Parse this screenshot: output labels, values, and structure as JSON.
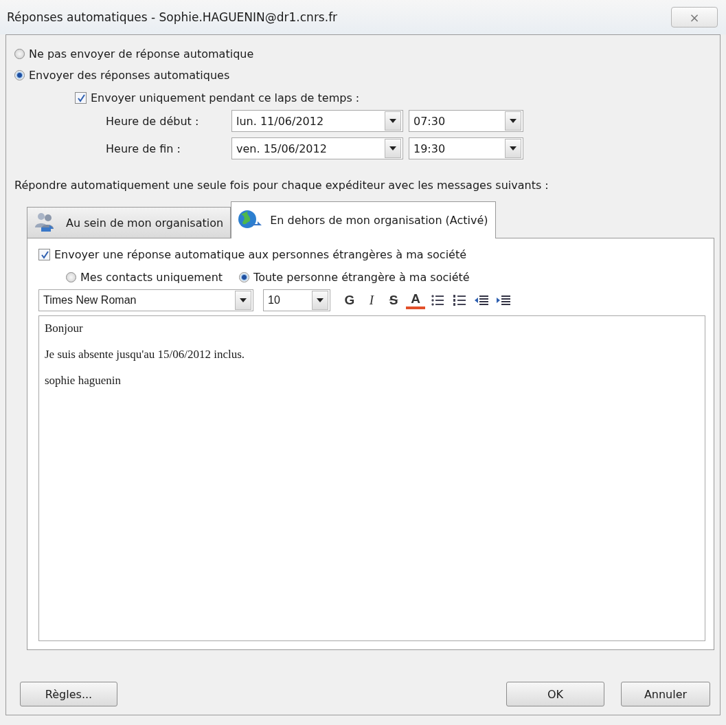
{
  "window": {
    "title": "Réponses automatiques - Sophie.HAGUENIN@dr1.cnrs.fr",
    "close": "⨯"
  },
  "reply_mode": [
    {
      "label": "Ne pas envoyer de réponse automatique",
      "selected": false
    },
    {
      "label": "Envoyer des réponses automatiques",
      "selected": true
    }
  ],
  "time_range": {
    "label": "Envoyer uniquement pendant ce laps de temps :",
    "checked": true,
    "rows": [
      {
        "label": "Heure de début :",
        "date": "lun. 11/06/2012",
        "time": "07:30"
      },
      {
        "label": "Heure de fin :",
        "date": "ven. 15/06/2012",
        "time": "19:30"
      }
    ]
  },
  "prompt": "Répondre automatiquement une seule fois pour chaque expéditeur avec les messages suivants :",
  "tabs": [
    {
      "label": "Au sein de mon organisation",
      "selected": false
    },
    {
      "label": "En dehors de mon organisation (Activé)",
      "selected": true
    }
  ],
  "outside": {
    "label": "Envoyer une réponse automatique aux personnes étrangères à ma société",
    "checked": true,
    "audience": [
      {
        "label": "Mes contacts uniquement",
        "selected": false
      },
      {
        "label": "Toute personne étrangère à ma société",
        "selected": true
      }
    ]
  },
  "toolbar": {
    "font": "Times New Roman",
    "size": "10",
    "buttons": [
      {
        "kind": "bold",
        "text": "G"
      },
      {
        "kind": "italic",
        "text": "I"
      },
      {
        "kind": "strike",
        "text": "S"
      },
      {
        "kind": "color",
        "text": "A"
      },
      {
        "kind": "bullets"
      },
      {
        "kind": "numbers"
      },
      {
        "kind": "outdent"
      },
      {
        "kind": "indent"
      }
    ]
  },
  "message": [
    "Bonjour",
    "Je suis absente jusqu'au 15/06/2012 inclus.",
    "sophie haguenin"
  ],
  "buttons": {
    "rules": "Règles...",
    "ok": "OK",
    "cancel": "Annuler"
  }
}
